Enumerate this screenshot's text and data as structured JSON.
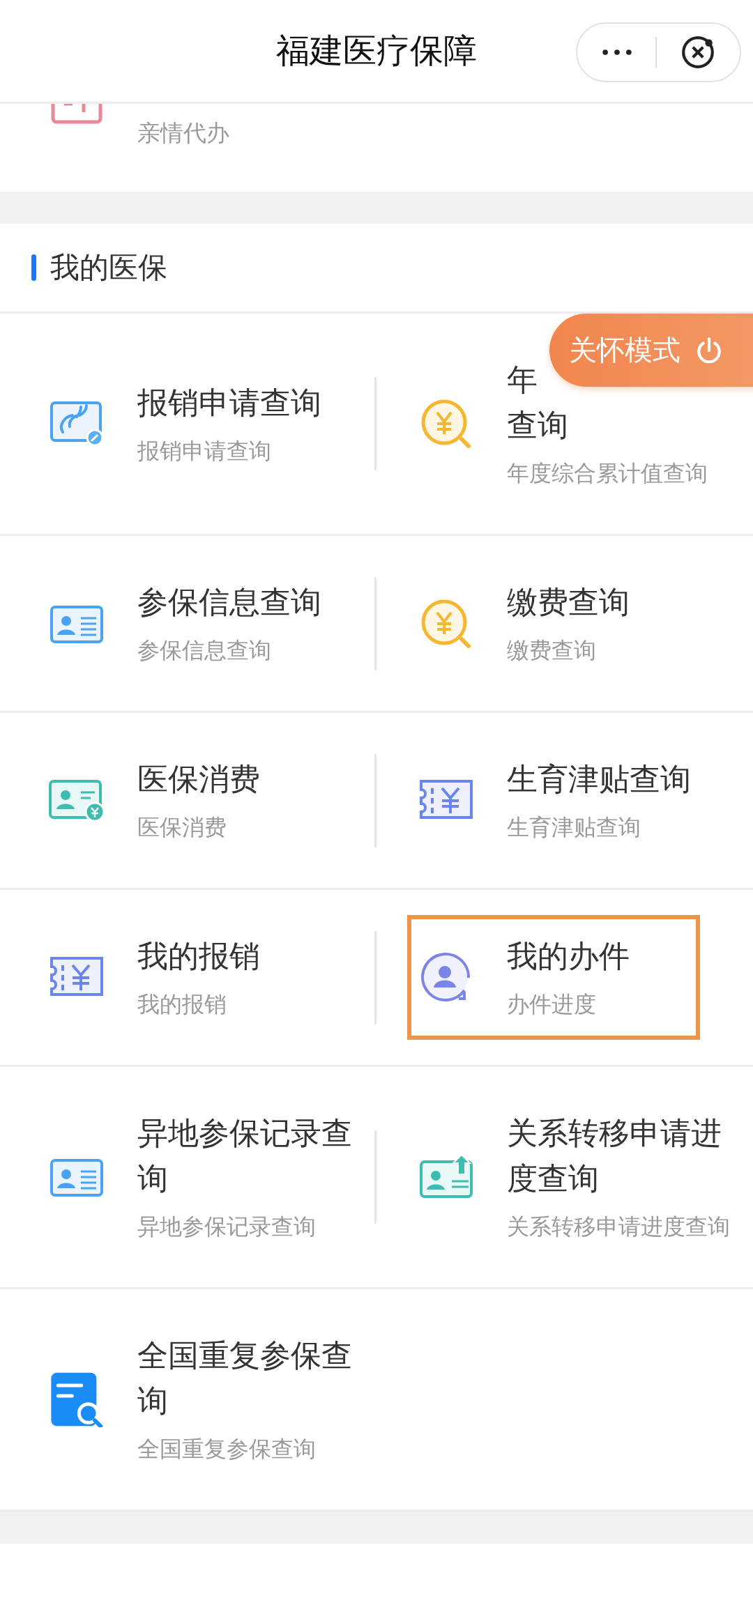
{
  "header": {
    "title": "福建医疗保障"
  },
  "top_item": {
    "kind": "upload-box",
    "subtitle": "亲情代办"
  },
  "section": {
    "title": "我的医保"
  },
  "care_mode": {
    "label": "关怀模式"
  },
  "rows": [
    {
      "items": [
        {
          "kind": "reimburse",
          "title": "报销申请查询",
          "subtitle": "报销申请查询",
          "highlighted": false
        },
        {
          "kind": "yuan-search",
          "title": [
            "年",
            "查询"
          ],
          "subtitle": "年度综合累计值查询",
          "highlighted": false
        }
      ]
    },
    {
      "items": [
        {
          "kind": "id-card",
          "title": "参保信息查询",
          "subtitle": "参保信息查询",
          "highlighted": false
        },
        {
          "kind": "yuan-search",
          "title": "缴费查询",
          "subtitle": "缴费查询",
          "highlighted": false
        }
      ]
    },
    {
      "items": [
        {
          "kind": "card-yuan",
          "title": "医保消费",
          "subtitle": "医保消费",
          "highlighted": false
        },
        {
          "kind": "ticket-yuan",
          "title": "生育津贴查询",
          "subtitle": "生育津贴查询",
          "highlighted": false
        }
      ]
    },
    {
      "items": [
        {
          "kind": "ticket-yuan",
          "title": "我的报销",
          "subtitle": "我的报销",
          "highlighted": false
        },
        {
          "kind": "person-refresh",
          "title": "我的办件",
          "subtitle": "办件进度",
          "highlighted": true
        }
      ]
    },
    {
      "items": [
        {
          "kind": "id-card",
          "title": "异地参保记录查询",
          "subtitle": "异地参保记录查询",
          "highlighted": false
        },
        {
          "kind": "card-upload",
          "title": "关系转移申请进度查询",
          "subtitle": "关系转移申请进度查询",
          "highlighted": false
        }
      ]
    },
    {
      "items": [
        {
          "kind": "doc-search",
          "title": "全国重复参保查询",
          "subtitle": "全国重复参保查询",
          "highlighted": false
        }
      ]
    }
  ]
}
